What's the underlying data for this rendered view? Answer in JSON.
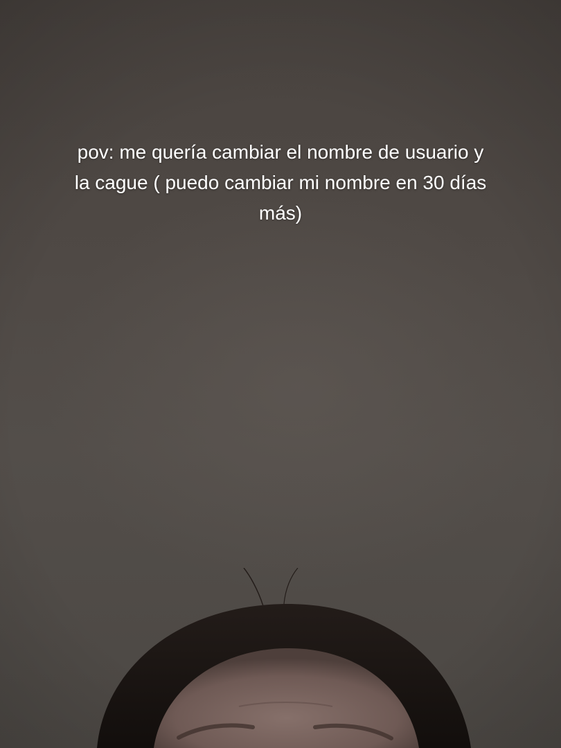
{
  "caption": {
    "text": "pov: me quería cambiar el nombre de usuario y la cague ( puedo cambiar mi nombre en 30 días más)"
  },
  "scene": {
    "background_color": "#4f4945",
    "hair_color": "#1c1614",
    "skin_color": "#7b6560",
    "subject": "top-of-head"
  }
}
